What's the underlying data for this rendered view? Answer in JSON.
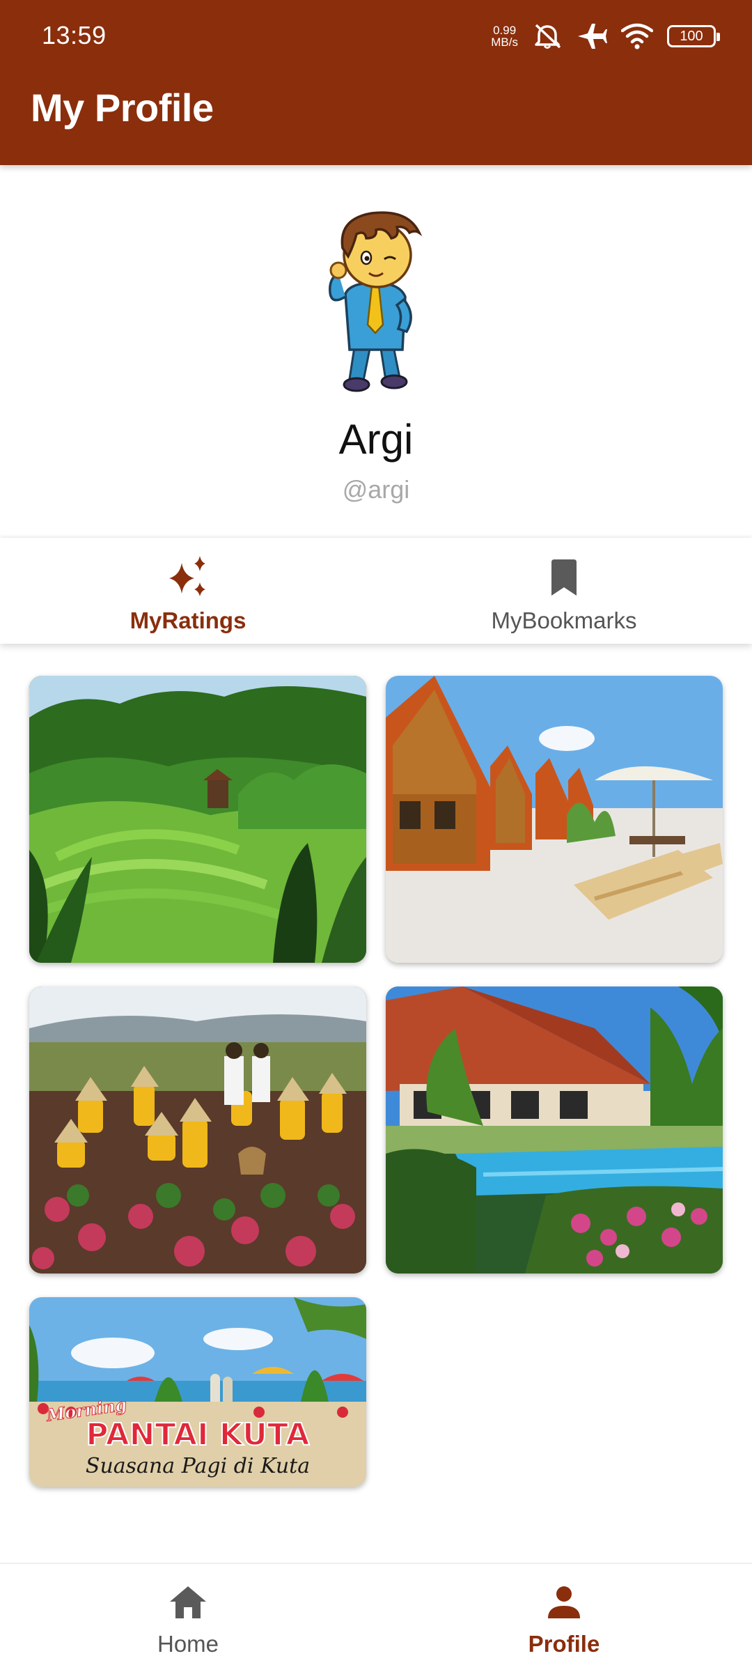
{
  "status_bar": {
    "time": "13:59",
    "net_speed_value": "0.99",
    "net_speed_unit": "MB/s",
    "battery": "100",
    "icons": [
      "mute-icon",
      "airplane-icon",
      "wifi-icon",
      "battery-icon"
    ]
  },
  "header": {
    "title": "My Profile"
  },
  "profile": {
    "name": "Argi",
    "handle": "@argi",
    "avatar_icon": "cartoon-businessman-avatar"
  },
  "tabs": [
    {
      "label": "MyRatings",
      "icon": "sparkles-icon",
      "active": true
    },
    {
      "label": "MyBookmarks",
      "icon": "bookmark-icon",
      "active": false
    }
  ],
  "gallery": {
    "items": [
      {
        "scene": "rice-terrace"
      },
      {
        "scene": "wooden-bungalows"
      },
      {
        "scene": "farm-children"
      },
      {
        "scene": "resort-pool"
      },
      {
        "scene": "beach-banner",
        "overlay_top": "Morning",
        "overlay_main": "PANTAI KUTA",
        "overlay_sub": "Suasana Pagi di Kuta"
      }
    ]
  },
  "bottom_nav": [
    {
      "label": "Home",
      "icon": "home-icon",
      "active": false
    },
    {
      "label": "Profile",
      "icon": "person-icon",
      "active": true
    }
  ],
  "colors": {
    "primary": "#8a2e0c",
    "inactive": "#555555",
    "handle_gray": "#a8a8a8"
  }
}
